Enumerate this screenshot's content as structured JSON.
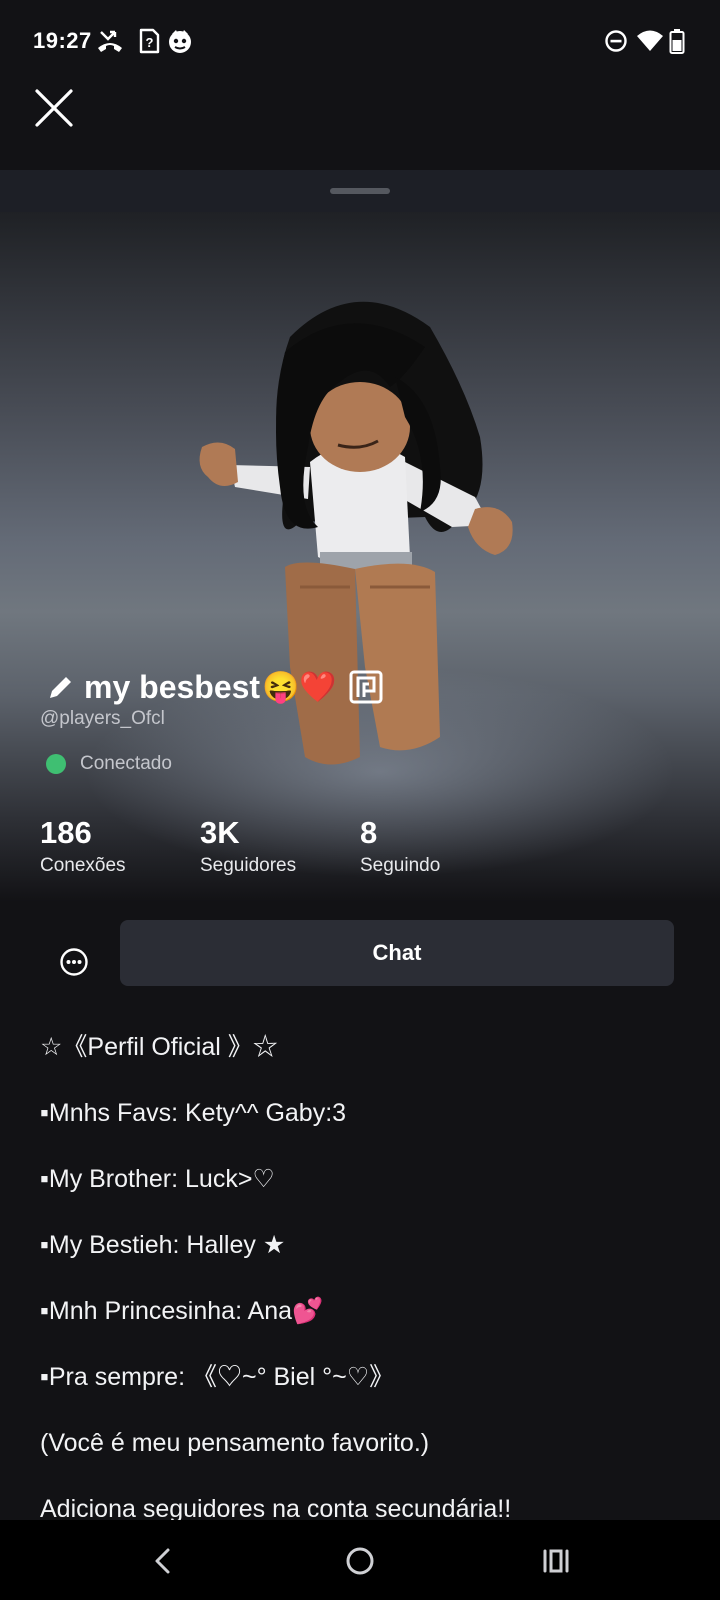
{
  "status_bar": {
    "time": "19:27",
    "left_icons": [
      "missed-call-icon",
      "sim-question-icon",
      "notification-app-icon"
    ],
    "right_icons": [
      "do-not-disturb-icon",
      "wifi-icon",
      "battery-icon"
    ]
  },
  "header": {
    "close_icon": "close-icon"
  },
  "profile": {
    "display_name": "my besbest",
    "display_name_emojis": "😝❤️",
    "username": "@players_Ofcl",
    "presence": "Conectado",
    "presence_color": "#3fbf72"
  },
  "stats": [
    {
      "value": "186",
      "label": "Conexões"
    },
    {
      "value": "3K",
      "label": "Seguidores"
    },
    {
      "value": "8",
      "label": "Seguindo"
    }
  ],
  "actions": {
    "chat_label": "Chat",
    "more_icon": "more-options-icon"
  },
  "bio_lines": [
    "☆《Perfil Oficial 》☆",
    "▪Mnhs Favs: Kety^^ Gaby:3",
    "▪My Brother: Luck>♡",
    "▪My Bestieh: Halley ★",
    "▪Mnh Princesinha: Ana💕",
    "▪Pra sempre: 《♡~° Biel °~♡》",
    "(Você é meu pensamento favorito.)",
    "Adiciona seguidores na conta secundária!!"
  ],
  "nav_bar": {
    "icons": [
      "back-icon",
      "home-icon",
      "recents-icon"
    ]
  }
}
